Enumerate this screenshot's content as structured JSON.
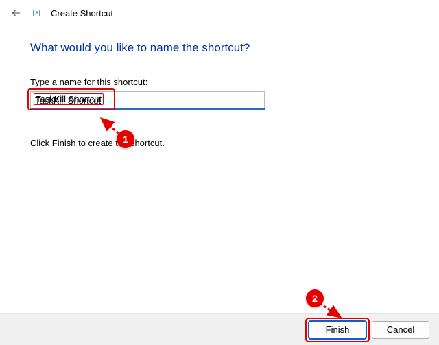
{
  "window": {
    "title": "Create Shortcut"
  },
  "page": {
    "heading": "What would you like to name the shortcut?",
    "input_label": "Type a name for this shortcut:",
    "input_value": "TaskKill Shortcut",
    "instruction": "Click Finish to create the shortcut."
  },
  "buttons": {
    "finish": "Finish",
    "cancel": "Cancel"
  },
  "annotations": {
    "callout1": "1",
    "callout2": "2"
  }
}
